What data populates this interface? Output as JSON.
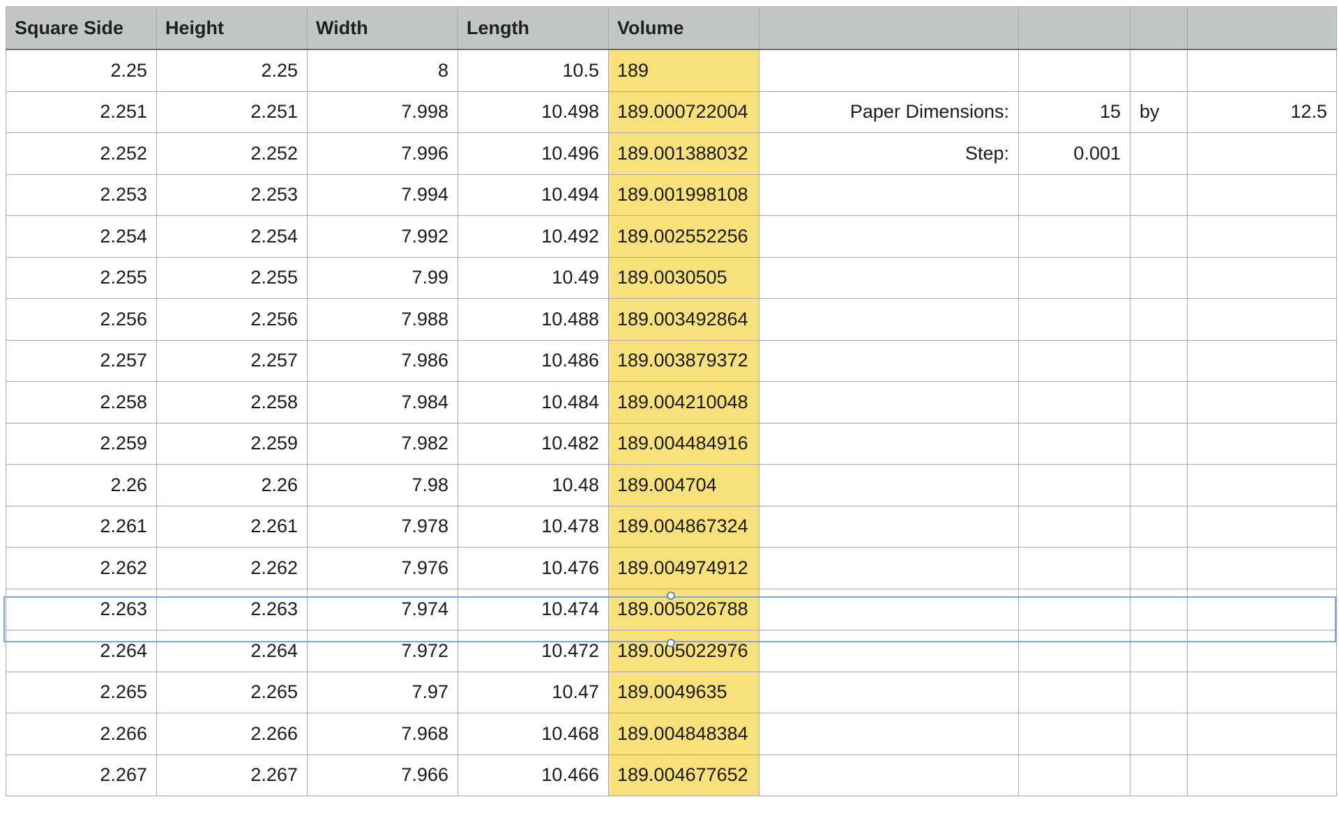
{
  "columns": [
    "Square Side",
    "Height",
    "Width",
    "Length",
    "Volume",
    "",
    "",
    "",
    ""
  ],
  "rows": [
    {
      "square_side": "2.25",
      "height": "2.25",
      "width": "8",
      "length": "10.5",
      "volume": "189",
      "f": "",
      "g": "",
      "h": "",
      "i": ""
    },
    {
      "square_side": "2.251",
      "height": "2.251",
      "width": "7.998",
      "length": "10.498",
      "volume": "189.000722004",
      "f": "Paper Dimensions:",
      "g": "15",
      "h": "by",
      "i": "12.5"
    },
    {
      "square_side": "2.252",
      "height": "2.252",
      "width": "7.996",
      "length": "10.496",
      "volume": "189.001388032",
      "f": "Step:",
      "g": "0.001",
      "h": "",
      "i": ""
    },
    {
      "square_side": "2.253",
      "height": "2.253",
      "width": "7.994",
      "length": "10.494",
      "volume": "189.001998108",
      "f": "",
      "g": "",
      "h": "",
      "i": ""
    },
    {
      "square_side": "2.254",
      "height": "2.254",
      "width": "7.992",
      "length": "10.492",
      "volume": "189.002552256",
      "f": "",
      "g": "",
      "h": "",
      "i": ""
    },
    {
      "square_side": "2.255",
      "height": "2.255",
      "width": "7.99",
      "length": "10.49",
      "volume": "189.0030505",
      "f": "",
      "g": "",
      "h": "",
      "i": ""
    },
    {
      "square_side": "2.256",
      "height": "2.256",
      "width": "7.988",
      "length": "10.488",
      "volume": "189.003492864",
      "f": "",
      "g": "",
      "h": "",
      "i": ""
    },
    {
      "square_side": "2.257",
      "height": "2.257",
      "width": "7.986",
      "length": "10.486",
      "volume": "189.003879372",
      "f": "",
      "g": "",
      "h": "",
      "i": ""
    },
    {
      "square_side": "2.258",
      "height": "2.258",
      "width": "7.984",
      "length": "10.484",
      "volume": "189.004210048",
      "f": "",
      "g": "",
      "h": "",
      "i": ""
    },
    {
      "square_side": "2.259",
      "height": "2.259",
      "width": "7.982",
      "length": "10.482",
      "volume": "189.004484916",
      "f": "",
      "g": "",
      "h": "",
      "i": ""
    },
    {
      "square_side": "2.26",
      "height": "2.26",
      "width": "7.98",
      "length": "10.48",
      "volume": "189.004704",
      "f": "",
      "g": "",
      "h": "",
      "i": ""
    },
    {
      "square_side": "2.261",
      "height": "2.261",
      "width": "7.978",
      "length": "10.478",
      "volume": "189.004867324",
      "f": "",
      "g": "",
      "h": "",
      "i": ""
    },
    {
      "square_side": "2.262",
      "height": "2.262",
      "width": "7.976",
      "length": "10.476",
      "volume": "189.004974912",
      "f": "",
      "g": "",
      "h": "",
      "i": ""
    },
    {
      "square_side": "2.263",
      "height": "2.263",
      "width": "7.974",
      "length": "10.474",
      "volume": "189.005026788",
      "f": "",
      "g": "",
      "h": "",
      "i": ""
    },
    {
      "square_side": "2.264",
      "height": "2.264",
      "width": "7.972",
      "length": "10.472",
      "volume": "189.005022976",
      "f": "",
      "g": "",
      "h": "",
      "i": ""
    },
    {
      "square_side": "2.265",
      "height": "2.265",
      "width": "7.97",
      "length": "10.47",
      "volume": "189.0049635",
      "f": "",
      "g": "",
      "h": "",
      "i": ""
    },
    {
      "square_side": "2.266",
      "height": "2.266",
      "width": "7.968",
      "length": "10.468",
      "volume": "189.004848384",
      "f": "",
      "g": "",
      "h": "",
      "i": ""
    },
    {
      "square_side": "2.267",
      "height": "2.267",
      "width": "7.966",
      "length": "10.466",
      "volume": "189.004677652",
      "f": "",
      "g": "",
      "h": "",
      "i": ""
    }
  ],
  "selected_row": 13,
  "colors": {
    "header_bg": "#c4c6c6",
    "volume_highlight": "#f8e07b",
    "grid_line": "#a8a8a8",
    "selection": "#7fa4d8"
  }
}
